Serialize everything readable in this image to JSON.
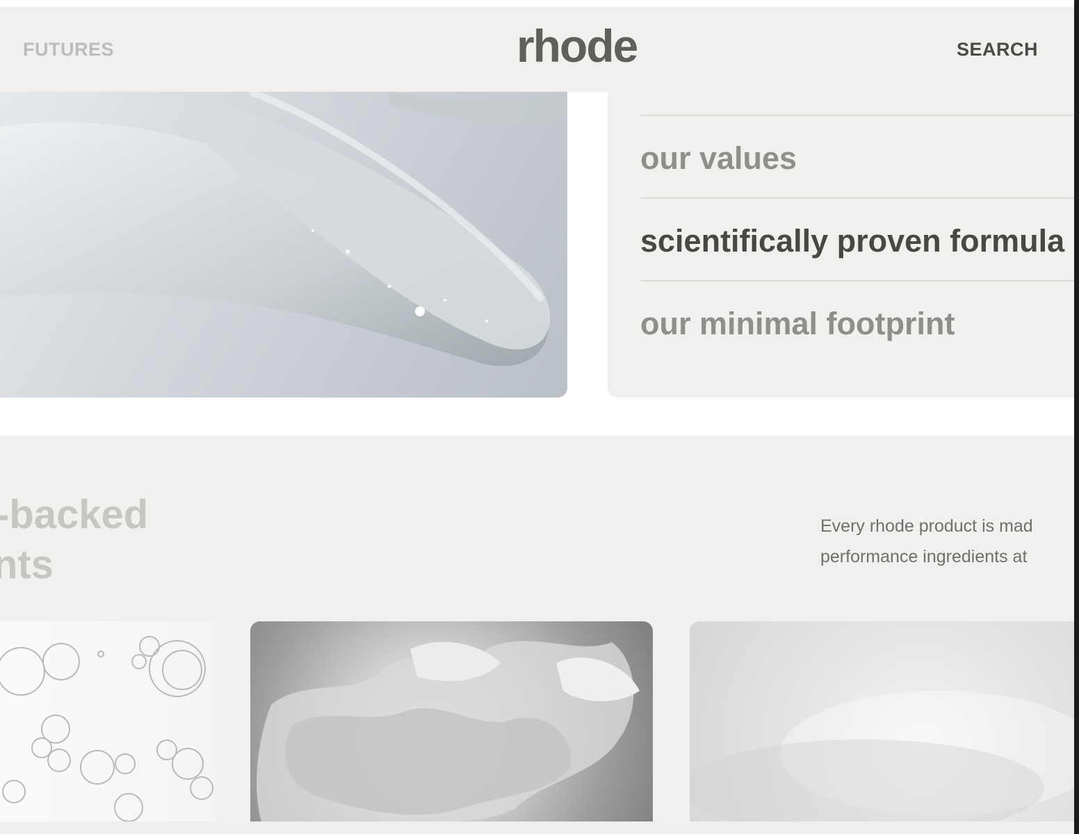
{
  "header": {
    "nav_left": "FUTURES",
    "logo": "rhode",
    "nav_right": "SEARCH"
  },
  "values_menu": {
    "items": [
      {
        "label": "our values",
        "active": false
      },
      {
        "label": "scientifically proven formula",
        "active": true
      },
      {
        "label": "our minimal footprint",
        "active": false
      }
    ]
  },
  "ingredients_section": {
    "heading_line1": "-backed",
    "heading_line2": "nts",
    "description_line1": "Every rhode product is mad",
    "description_line2": "performance ingredients at"
  },
  "colors": {
    "header_bg": "#f1f0ee",
    "panel_bg": "#f1f0ee",
    "text_dark": "#474744",
    "text_muted": "#8e8e8b"
  }
}
